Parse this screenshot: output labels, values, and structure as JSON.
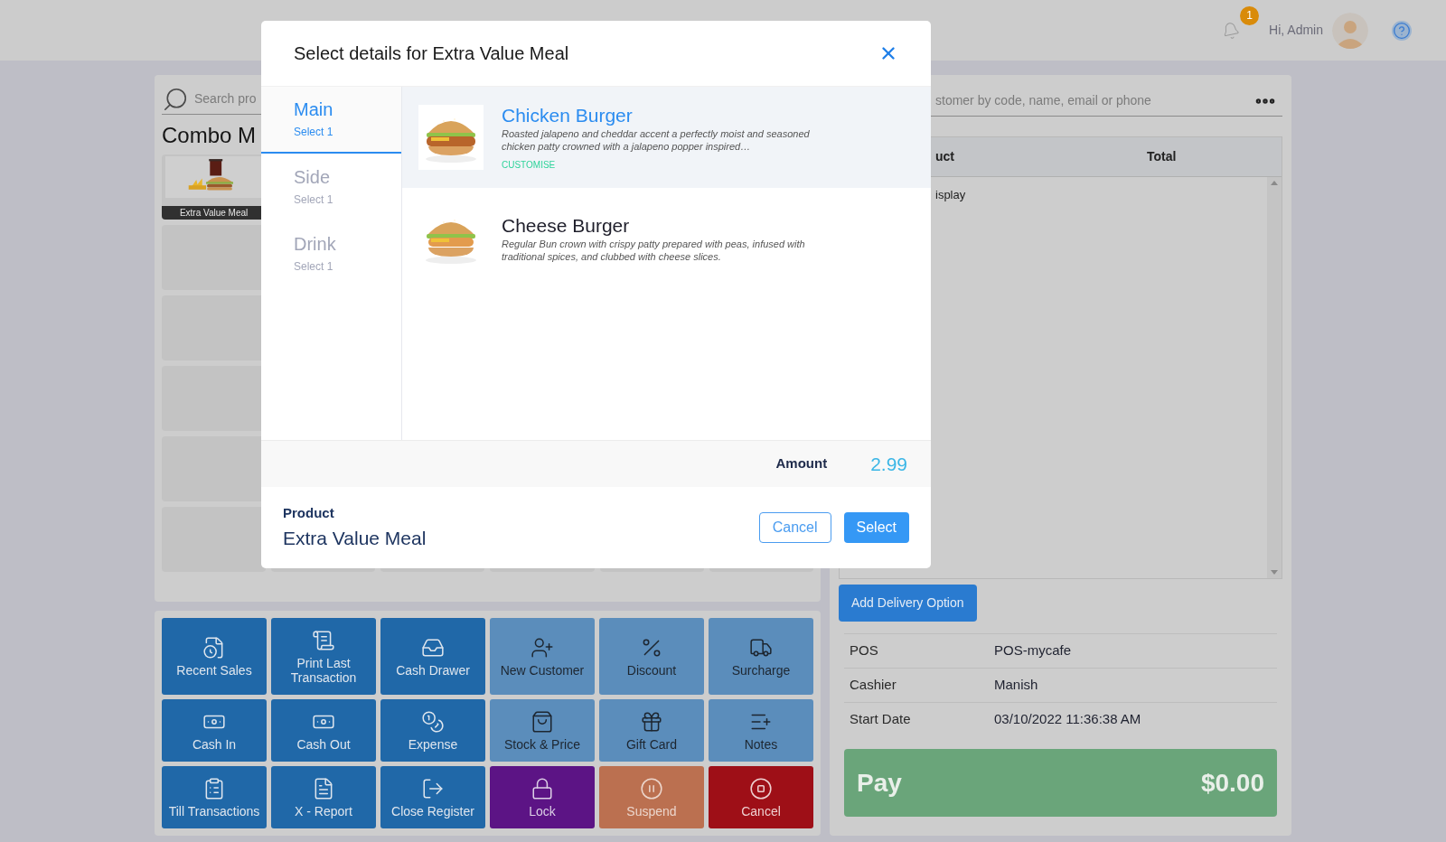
{
  "header": {
    "notification_count": "1",
    "greeting": "Hi, Admin"
  },
  "products_panel": {
    "search_placeholder": "Search pro",
    "category_title": "Combo M",
    "products": [
      {
        "label": "Extra Value Meal"
      }
    ]
  },
  "actions": [
    {
      "label": "Recent Sales",
      "kind": "primary"
    },
    {
      "label": "Print Last Transaction",
      "kind": "primary"
    },
    {
      "label": "Cash Drawer",
      "kind": "primary"
    },
    {
      "label": "New Customer",
      "kind": "secondary"
    },
    {
      "label": "Discount",
      "kind": "secondary"
    },
    {
      "label": "Surcharge",
      "kind": "secondary"
    },
    {
      "label": "Cash In",
      "kind": "primary"
    },
    {
      "label": "Cash Out",
      "kind": "primary"
    },
    {
      "label": "Expense",
      "kind": "primary"
    },
    {
      "label": "Stock & Price",
      "kind": "secondary"
    },
    {
      "label": "Gift Card",
      "kind": "secondary"
    },
    {
      "label": "Notes",
      "kind": "secondary"
    },
    {
      "label": "Till Transactions",
      "kind": "primary"
    },
    {
      "label": "X - Report",
      "kind": "primary"
    },
    {
      "label": "Close Register",
      "kind": "primary"
    },
    {
      "label": "Lock",
      "kind": "lock"
    },
    {
      "label": "Suspend",
      "kind": "suspend"
    },
    {
      "label": "Cancel",
      "kind": "cancel"
    }
  ],
  "cart": {
    "customer_placeholder": "stomer by code, name, email or phone",
    "columns": [
      "uct",
      "Total"
    ],
    "rows": [
      "isplay"
    ],
    "delivery_button": "Add Delivery Option",
    "info": [
      {
        "label": "POS",
        "value": "POS-mycafe"
      },
      {
        "label": "Cashier",
        "value": "Manish"
      },
      {
        "label": "Start Date",
        "value": "03/10/2022 11:36:38 AM"
      }
    ],
    "pay": {
      "label": "Pay",
      "amount": "$0.00"
    }
  },
  "modal": {
    "title": "Select details for Extra Value Meal",
    "tabs": [
      {
        "name": "Main",
        "hint": "Select 1",
        "selected": true
      },
      {
        "name": "Side",
        "hint": "Select 1",
        "selected": false
      },
      {
        "name": "Drink",
        "hint": "Select 1",
        "selected": false
      }
    ],
    "options": [
      {
        "name": "Chicken Burger",
        "description": "Roasted jalapeno and cheddar accent a perfectly moist and seasoned chicken patty crowned with a jalapeno popper inspired…",
        "action": "CUSTOMISE",
        "selected": true
      },
      {
        "name": "Cheese Burger",
        "description": "Regular Bun crown with crispy patty prepared with peas, infused with traditional spices, and clubbed with cheese slices.",
        "selected": false
      }
    ],
    "amount_label": "Amount",
    "amount": "2.99",
    "product_label": "Product",
    "product": "Extra Value Meal",
    "buttons": [
      {
        "label": "Cancel",
        "kind": "secondary"
      },
      {
        "label": "Select",
        "kind": "primary"
      }
    ]
  }
}
